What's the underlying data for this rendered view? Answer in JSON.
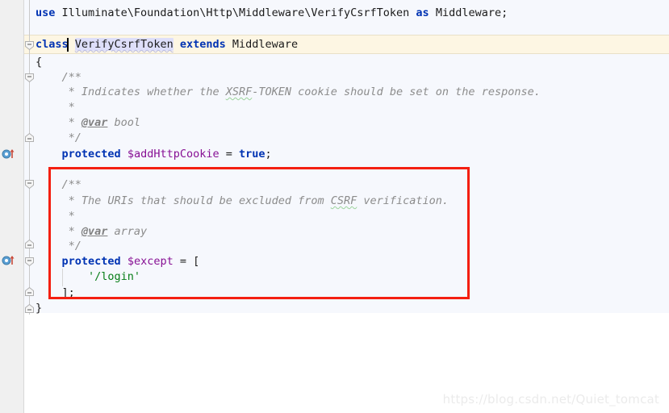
{
  "editor": {
    "language": "php",
    "background_color": "#f6f8fd",
    "gutter_color": "#f0f0f0",
    "caret_line_color": "#fdf6e3",
    "selection_color": "#dedffa",
    "annotation_color": "#f41f11"
  },
  "code": {
    "line1": {
      "kw_use": "use",
      "namespace": " Illuminate\\Foundation\\Http\\Middleware\\VerifyCsrfToken ",
      "kw_as": "as",
      "alias": " Middleware;"
    },
    "line2": {
      "kw_class": "class",
      "space1": " ",
      "class_name": "VerifyCsrfToken",
      "space2": " ",
      "kw_extends": "extends",
      "parent": " Middleware"
    },
    "line3": "{",
    "line4": "    /**",
    "line5": {
      "prefix": "     * Indicates whether the ",
      "spelled": "XSRF",
      "suffix": "-TOKEN cookie should be set on the response."
    },
    "line6": "     *",
    "line7": {
      "prefix": "     * ",
      "tag": "@var",
      "suffix": " bool"
    },
    "line8": "     */",
    "line9": {
      "kw": "protected",
      "space": " ",
      "var": "$addHttpCookie",
      "op": " = ",
      "value": "true",
      "semi": ";"
    },
    "line10": "    /**",
    "line11": {
      "prefix": "     * The URIs that should be excluded from ",
      "spelled": "CSRF",
      "suffix": " verification."
    },
    "line12": "     *",
    "line13": {
      "prefix": "     * ",
      "tag": "@var",
      "suffix": " array"
    },
    "line14": "     */",
    "line15": {
      "kw": "protected",
      "space": " ",
      "var": "$except",
      "op": " = ",
      "bracket": "["
    },
    "line16": {
      "indent": "        ",
      "string": "'/login'"
    },
    "line17": "    ];",
    "line18": "}"
  },
  "gutter": {
    "icon_1_name": "overridden-member-icon",
    "icon_2_name": "overridden-member-icon",
    "fold_markers": [
      "fold-class",
      "fold-docblock-1",
      "fold-docblock-1-end",
      "fold-docblock-2",
      "fold-docblock-2-end",
      "fold-array",
      "fold-array-end",
      "fold-class-end"
    ]
  },
  "annotation": {
    "name": "red-highlight-box",
    "target": "except property docblock and declaration"
  },
  "watermark": {
    "text": "https://blog.csdn.net/Quiet_tomcat"
  }
}
